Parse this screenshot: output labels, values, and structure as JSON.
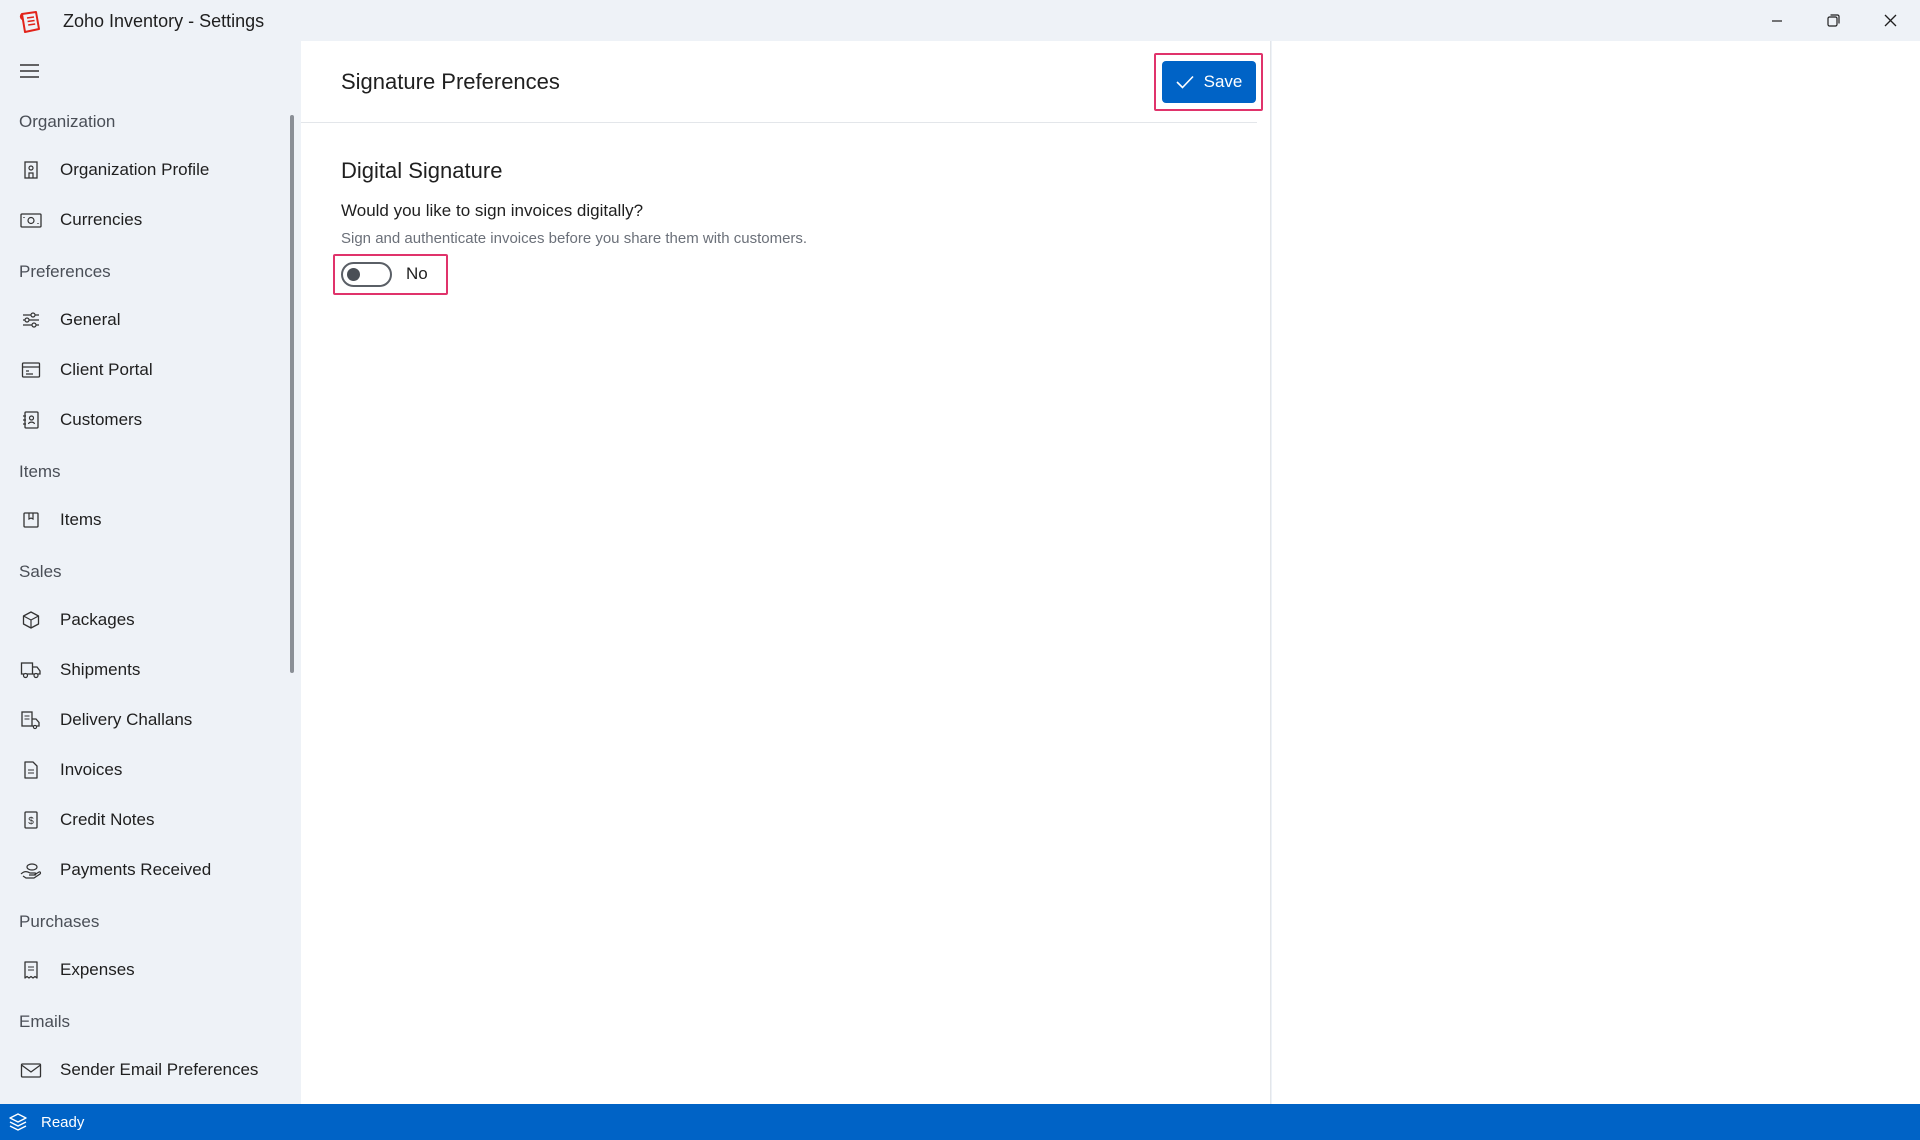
{
  "window": {
    "title": "Zoho Inventory - Settings",
    "icons": [
      "app-logo-icon",
      "minimize-icon",
      "restore-icon",
      "close-icon"
    ]
  },
  "sidebar": {
    "menu_icon": "hamburger-icon",
    "sections": [
      {
        "label": "Organization",
        "items": [
          {
            "label": "Organization Profile",
            "icon": "building-icon"
          },
          {
            "label": "Currencies",
            "icon": "currency-icon"
          }
        ]
      },
      {
        "label": "Preferences",
        "items": [
          {
            "label": "General",
            "icon": "sliders-icon"
          },
          {
            "label": "Client Portal",
            "icon": "browser-window-icon"
          },
          {
            "label": "Customers",
            "icon": "contact-book-icon"
          }
        ]
      },
      {
        "label": "Items",
        "items": [
          {
            "label": "Items",
            "icon": "item-box-icon"
          }
        ]
      },
      {
        "label": "Sales",
        "items": [
          {
            "label": "Packages",
            "icon": "package-icon"
          },
          {
            "label": "Shipments",
            "icon": "truck-icon"
          },
          {
            "label": "Delivery Challans",
            "icon": "delivery-challan-icon"
          },
          {
            "label": "Invoices",
            "icon": "invoice-icon"
          },
          {
            "label": "Credit Notes",
            "icon": "credit-note-icon"
          },
          {
            "label": "Payments Received",
            "icon": "payment-hand-icon"
          }
        ]
      },
      {
        "label": "Purchases",
        "items": [
          {
            "label": "Expenses",
            "icon": "receipt-icon"
          }
        ]
      },
      {
        "label": "Emails",
        "items": [
          {
            "label": "Sender Email Preferences",
            "icon": "envelope-icon"
          }
        ]
      }
    ]
  },
  "main": {
    "page_title": "Signature Preferences",
    "save_label": "Save",
    "section_title": "Digital Signature",
    "question": "Would you like to sign invoices digitally?",
    "hint": "Sign and authenticate invoices before you share them with customers.",
    "toggle": {
      "state": "off",
      "label": "No"
    }
  },
  "statusbar": {
    "text": "Ready",
    "icon": "layers-icon"
  },
  "colors": {
    "accent": "#0063c6",
    "highlight": "#e0336b",
    "sidebar_bg": "#eef2f7"
  }
}
